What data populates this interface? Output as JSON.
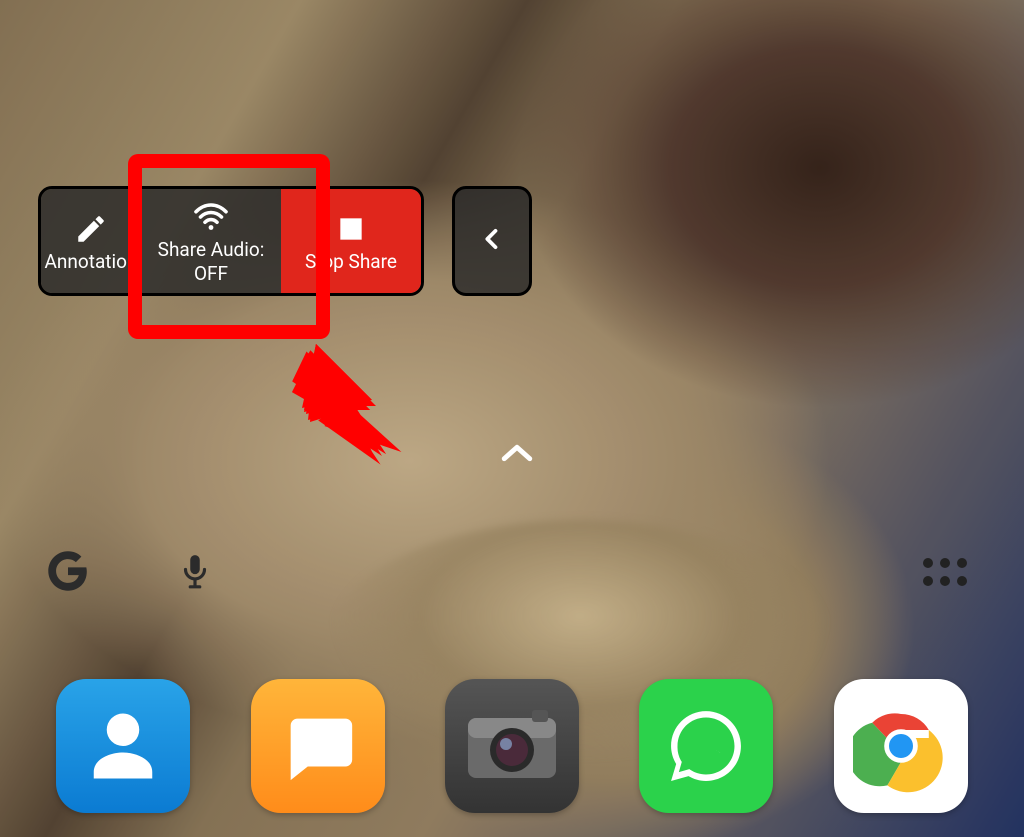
{
  "toolbar": {
    "annotation_label": "Annotation",
    "share_audio_label": "Share Audio:",
    "share_audio_state": "OFF",
    "stop_share_label": "Stop Share"
  },
  "dock": {
    "contacts": "Contacts",
    "messages": "Messages",
    "camera": "Camera",
    "whatsapp": "WhatsApp",
    "chrome": "Chrome"
  },
  "colors": {
    "stop_red": "#e0261c",
    "highlight_red": "#ff0000",
    "whatsapp_green": "#2bd24b",
    "contacts_blue": "#0b7bd2",
    "messages_orange": "#ff8c1a"
  }
}
